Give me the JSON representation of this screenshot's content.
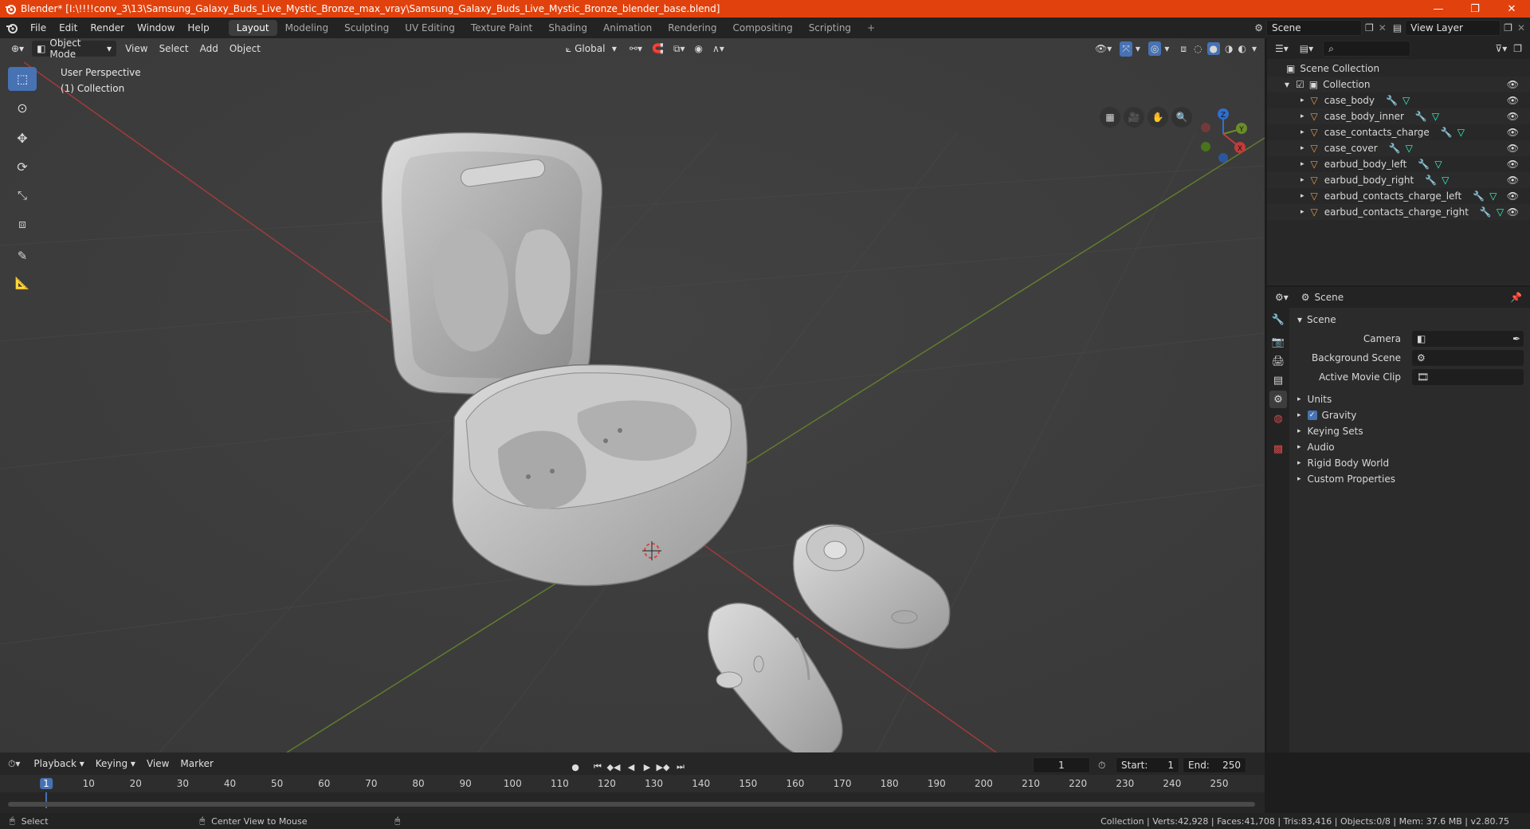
{
  "window": {
    "title": "Blender* [I:\\!!!!conv_3\\13\\Samsung_Galaxy_Buds_Live_Mystic_Bronze_max_vray\\Samsung_Galaxy_Buds_Live_Mystic_Bronze_blender_base.blend]",
    "minimize": "—",
    "maximize": "❐",
    "close": "✕"
  },
  "menu": [
    "File",
    "Edit",
    "Render",
    "Window",
    "Help"
  ],
  "workspaces": [
    "Layout",
    "Modeling",
    "Sculpting",
    "UV Editing",
    "Texture Paint",
    "Shading",
    "Animation",
    "Rendering",
    "Compositing",
    "Scripting"
  ],
  "active_workspace": "Layout",
  "scene_selector": {
    "label": "Scene"
  },
  "view_layer_selector": {
    "label": "View Layer"
  },
  "viewport": {
    "mode": "Object Mode",
    "menus": [
      "View",
      "Select",
      "Add",
      "Object"
    ],
    "transform_orientation": "Global",
    "overlay_line1": "User Perspective",
    "overlay_line2": "(1) Collection",
    "gizmo": {
      "x": "X",
      "y": "Y",
      "z": "Z"
    }
  },
  "outliner": {
    "root": "Scene Collection",
    "collection": "Collection",
    "objects": [
      "case_body",
      "case_body_inner",
      "case_contacts_charge",
      "case_cover",
      "earbud_body_left",
      "earbud_body_right",
      "earbud_contacts_charge_left",
      "earbud_contacts_charge_right"
    ]
  },
  "properties": {
    "header": "Scene",
    "panel_title": "Scene",
    "fields": [
      {
        "label": "Camera",
        "value": ""
      },
      {
        "label": "Background Scene",
        "value": ""
      },
      {
        "label": "Active Movie Clip",
        "value": ""
      }
    ],
    "sections": [
      "Units",
      "Gravity",
      "Keying Sets",
      "Audio",
      "Rigid Body World",
      "Custom Properties"
    ],
    "gravity_checked": true
  },
  "timeline": {
    "menus": [
      "Playback",
      "Keying",
      "View",
      "Marker"
    ],
    "current_frame": "1",
    "start_label": "Start:",
    "start": "1",
    "end_label": "End:",
    "end": "250",
    "ticks": [
      "1",
      "10",
      "20",
      "30",
      "40",
      "50",
      "60",
      "70",
      "80",
      "90",
      "100",
      "110",
      "120",
      "130",
      "140",
      "150",
      "160",
      "170",
      "180",
      "190",
      "200",
      "210",
      "220",
      "230",
      "240",
      "250"
    ]
  },
  "statusbar": {
    "left_action": "Select",
    "middle_action": "Center View to Mouse",
    "stats": "Collection | Verts:42,928 | Faces:41,708 | Tris:83,416 | Objects:0/8 | Mem: 37.6 MB | v2.80.75"
  },
  "colors": {
    "title_bar": "#e1420d",
    "accent_blue": "#4772b3",
    "axis_x": "#c43a3a",
    "axis_y": "#6a8c2a",
    "axis_z": "#2f6fd1"
  }
}
